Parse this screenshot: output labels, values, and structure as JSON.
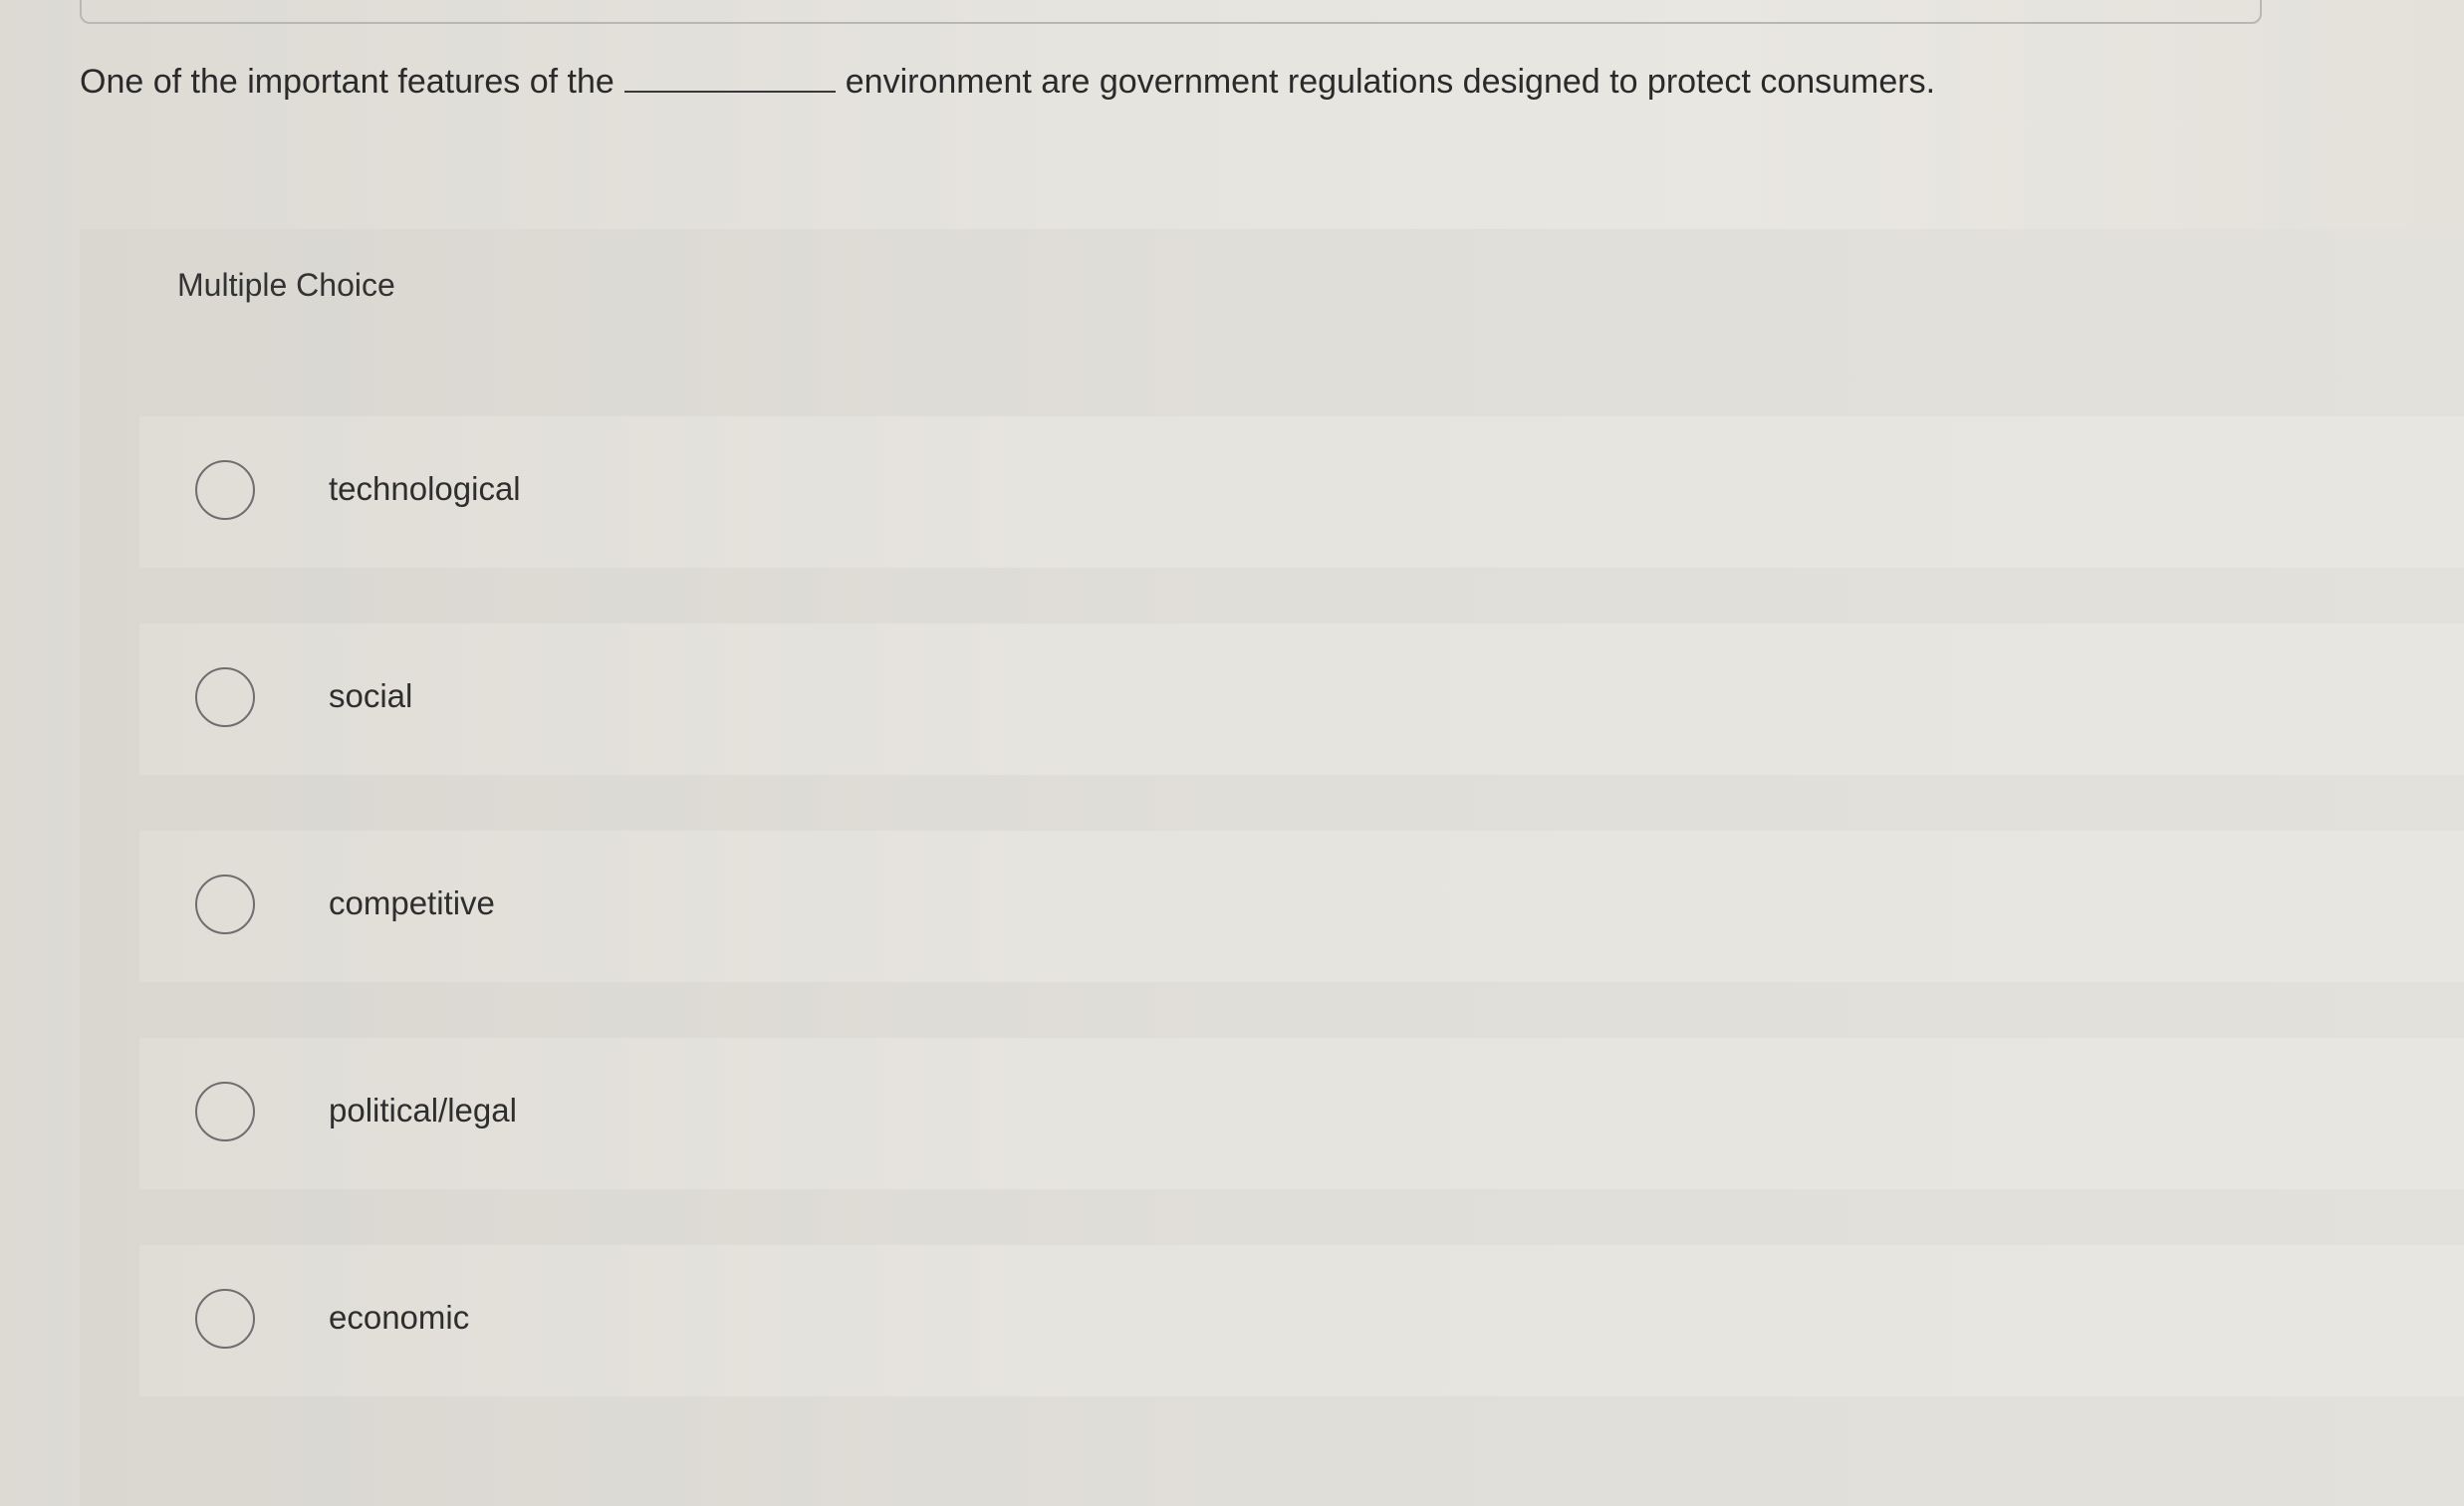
{
  "question": {
    "text_before": "One of the important features of the",
    "text_after": "environment are government regulations designed to protect consumers."
  },
  "multiple_choice": {
    "header": "Multiple Choice",
    "options": [
      {
        "label": "technological",
        "selected": false
      },
      {
        "label": "social",
        "selected": false
      },
      {
        "label": "competitive",
        "selected": false
      },
      {
        "label": "political/legal",
        "selected": false
      },
      {
        "label": "economic",
        "selected": false
      }
    ]
  }
}
